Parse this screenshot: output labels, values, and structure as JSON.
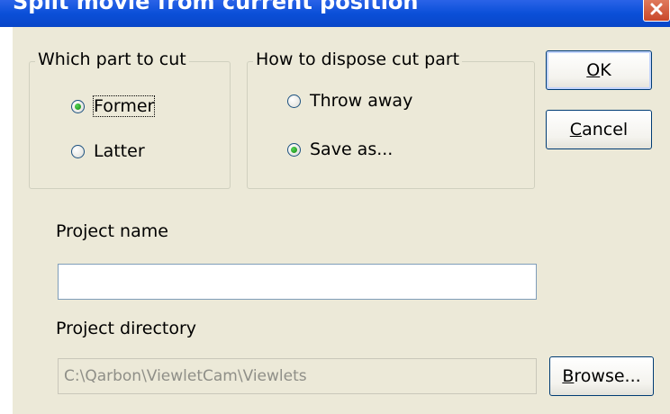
{
  "window": {
    "title": "Split movie from current position"
  },
  "cut_group": {
    "legend": "Which part to cut",
    "options": [
      {
        "label": "Former",
        "selected": true
      },
      {
        "label": "Latter",
        "selected": false
      }
    ]
  },
  "dispose_group": {
    "legend": "How to dispose cut part",
    "options": [
      {
        "label": "Throw away",
        "selected": false
      },
      {
        "label": "Save as...",
        "selected": true
      }
    ]
  },
  "buttons": {
    "ok_mnemonic": "O",
    "ok_rest": "K",
    "cancel_mnemonic": "C",
    "cancel_rest": "ancel",
    "browse_mnemonic": "B",
    "browse_rest": "rowse..."
  },
  "project": {
    "name_label": "Project name",
    "name_value": "",
    "directory_label": "Project directory",
    "directory_value": "C:\\Qarbon\\ViewletCam\\Viewlets"
  },
  "colors": {
    "titlebar": "#0b4fd8",
    "dialog_bg": "#ece9d8",
    "radio_dot": "#21a121",
    "button_border": "#003c74"
  }
}
